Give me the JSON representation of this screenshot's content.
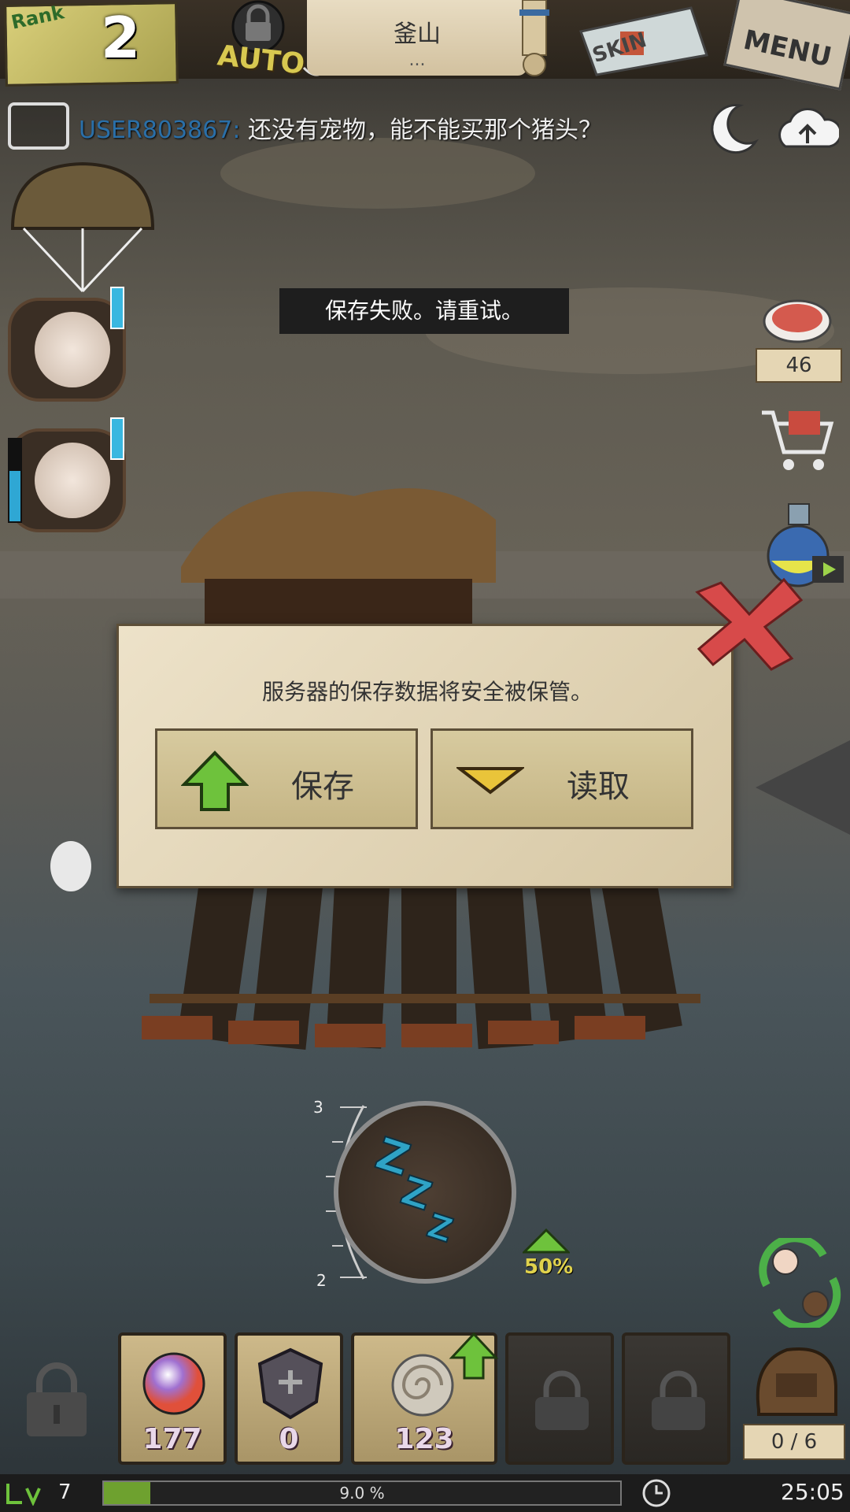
{
  "top_bar": {
    "rank_label": "Rank",
    "rank_value": "2",
    "auto_label": "AUTO",
    "location_name": "釜山",
    "location_sub": "...",
    "skin_label": "SKIN",
    "menu_label": "MENU"
  },
  "chat": {
    "user": "USER803867:",
    "message": " 还没有宠物，能不能买那个猪头？"
  },
  "toast": {
    "text": "保存失败。请重试。"
  },
  "meat": {
    "count": "46"
  },
  "dialog": {
    "message": "服务器的保存数据将安全被保管。",
    "save_label": "保存",
    "load_label": "读取"
  },
  "sleep": {
    "tick_top": "3",
    "tick_bottom": "2",
    "bonus": "50%"
  },
  "slots": [
    {
      "item": "orb",
      "count": "177"
    },
    {
      "item": "shield",
      "count": "0"
    },
    {
      "item": "shell",
      "count": "123"
    }
  ],
  "inventory": {
    "bag": "0 / 6"
  },
  "status": {
    "level": "7",
    "xp_text": "9.0 %",
    "xp_fraction": 0.09,
    "time": "25:05"
  },
  "colors": {
    "xp_fill": "#6ea12f",
    "username": "#2a6fa8",
    "zzz": "#2fa3c5",
    "close_x": "#d74a4a"
  },
  "icons": [
    "lock-icon",
    "anchor-icon",
    "scroll-icon",
    "chat-icon",
    "moon-icon",
    "cloud-upload-icon",
    "parachute-icon",
    "meat-icon",
    "cart-icon",
    "potion-icon",
    "close-icon",
    "arrow-up-icon",
    "arrow-down-icon",
    "zzz-icon",
    "trade-icon",
    "backpack-icon",
    "clock-icon",
    "level-icon"
  ]
}
